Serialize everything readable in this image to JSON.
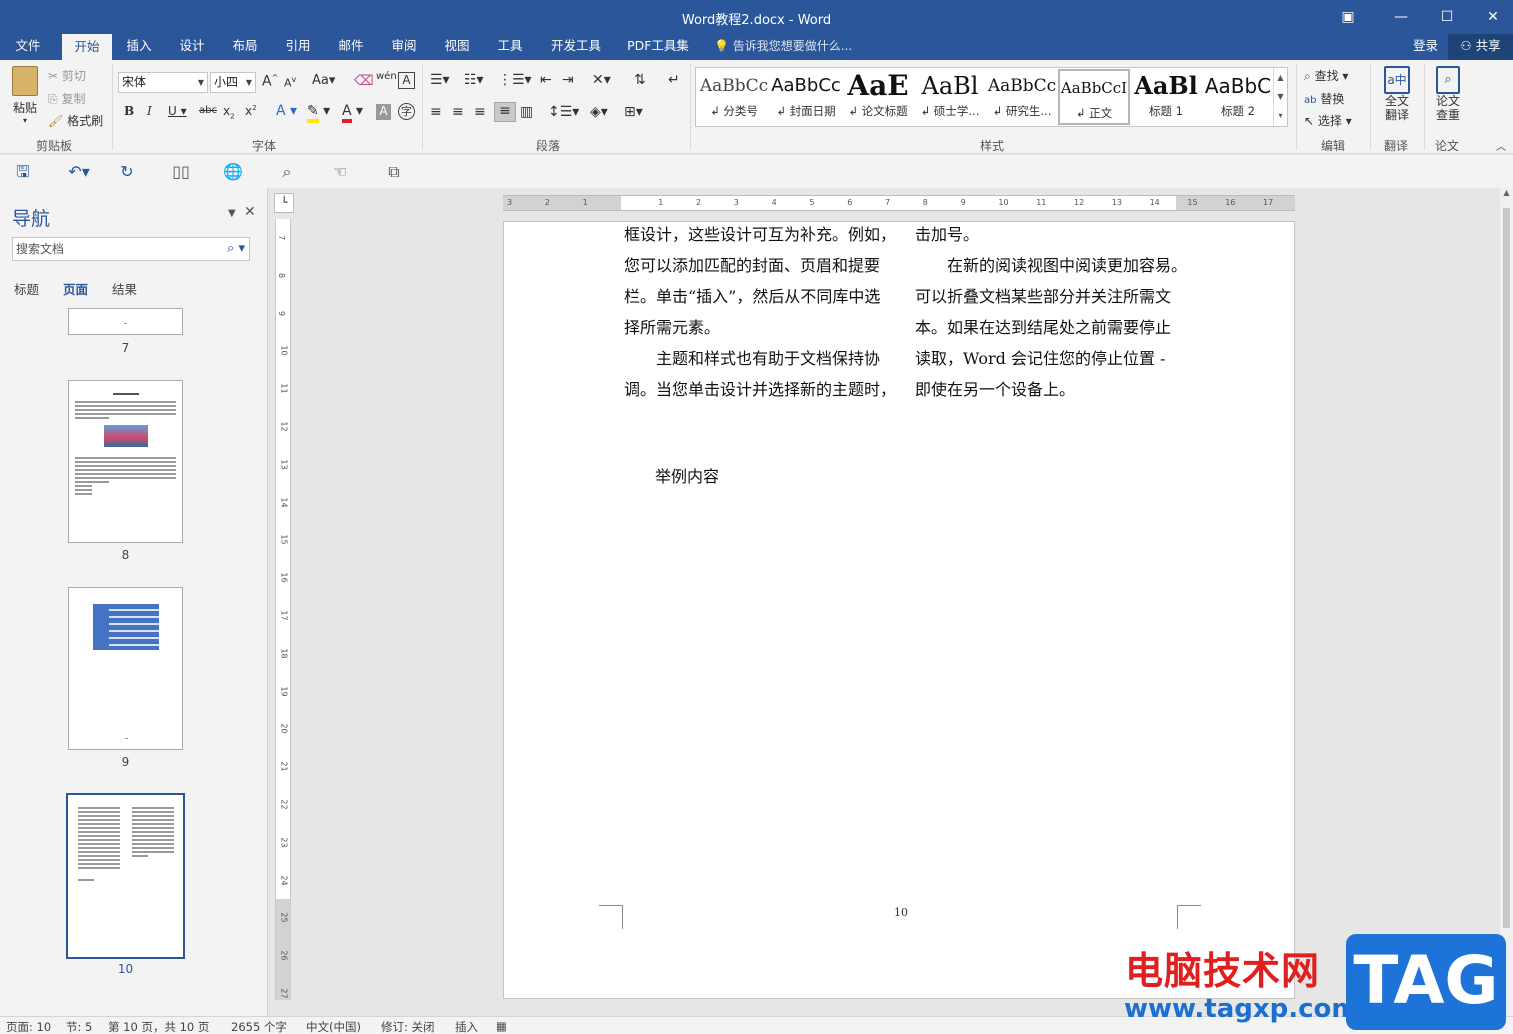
{
  "window": {
    "title": "Word教程2.docx - Word"
  },
  "tabs": [
    "文件",
    "开始",
    "插入",
    "设计",
    "布局",
    "引用",
    "邮件",
    "审阅",
    "视图",
    "工具",
    "开发工具",
    "PDF工具集"
  ],
  "tellme": "告诉我您想要做什么...",
  "account": {
    "login": "登录",
    "share": "共享"
  },
  "ribbon": {
    "clipboard": {
      "paste": "粘贴",
      "cut": "剪切",
      "copy": "复制",
      "format_painter": "格式刷",
      "label": "剪贴板"
    },
    "font": {
      "name": "宋体",
      "size": "小四",
      "label": "字体"
    },
    "paragraph": {
      "label": "段落"
    },
    "styles": {
      "label": "样式",
      "items": [
        {
          "preview": "AaBbCc",
          "name": "↲ 分类号"
        },
        {
          "preview": "AaBbCc",
          "name": "↲ 封面日期"
        },
        {
          "preview": "AaE",
          "name": "↲ 论文标题"
        },
        {
          "preview": "AaBl",
          "name": "↲ 硕士学..."
        },
        {
          "preview": "AaBbCc",
          "name": "↲ 研究生..."
        },
        {
          "preview": "AaBbCcI",
          "name": "↲ 正文"
        },
        {
          "preview": "AaBl",
          "name": "标题 1"
        },
        {
          "preview": "AaBbC",
          "name": "标题 2"
        }
      ]
    },
    "editing": {
      "find": "查找",
      "replace": "替换",
      "select": "选择",
      "label": "编辑"
    },
    "translate": {
      "button": "全文\n翻译",
      "line1": "全文",
      "line2": "翻译",
      "label": "翻译"
    },
    "paper": {
      "line1": "论文",
      "line2": "查重",
      "label": "论文"
    }
  },
  "nav": {
    "title": "导航",
    "search_placeholder": "搜索文档",
    "tabs": [
      "标题",
      "页面",
      "结果"
    ],
    "pages": [
      "7",
      "8",
      "9",
      "10"
    ]
  },
  "document": {
    "left_col": [
      "框设计，这些设计可互为补充。例如，",
      "您可以添加匹配的封面、页眉和提要",
      "栏。单击“插入”，然后从不同库中选",
      "择所需元素。",
      "　　主题和样式也有助于文档保持协",
      "调。当您单击设计并选择新的主题时，"
    ],
    "right_col": [
      "击加号。",
      "　　在新的阅读视图中阅读更加容易。",
      "可以折叠文档某些部分并关注所需文",
      "本。如果在达到结尾处之前需要停止",
      "读取，Word 会记住您的停止位置 -",
      "即使在另一个设备上。"
    ],
    "example": "举例内容",
    "page_number": "10"
  },
  "status": {
    "page": "页面: 10",
    "section": "节: 5",
    "pages": "第 10 页，共 10 页",
    "words": "2655 个字",
    "language": "中文(中国)",
    "track": "修订: 关闭",
    "insert": "插入"
  },
  "watermark": {
    "text": "电脑技术网",
    "url": "www.tagxp.com",
    "tag": "TAG"
  },
  "colors": {
    "accent": "#2b579a",
    "watermark_red": "#e02020",
    "watermark_blue": "#1e73d8"
  }
}
